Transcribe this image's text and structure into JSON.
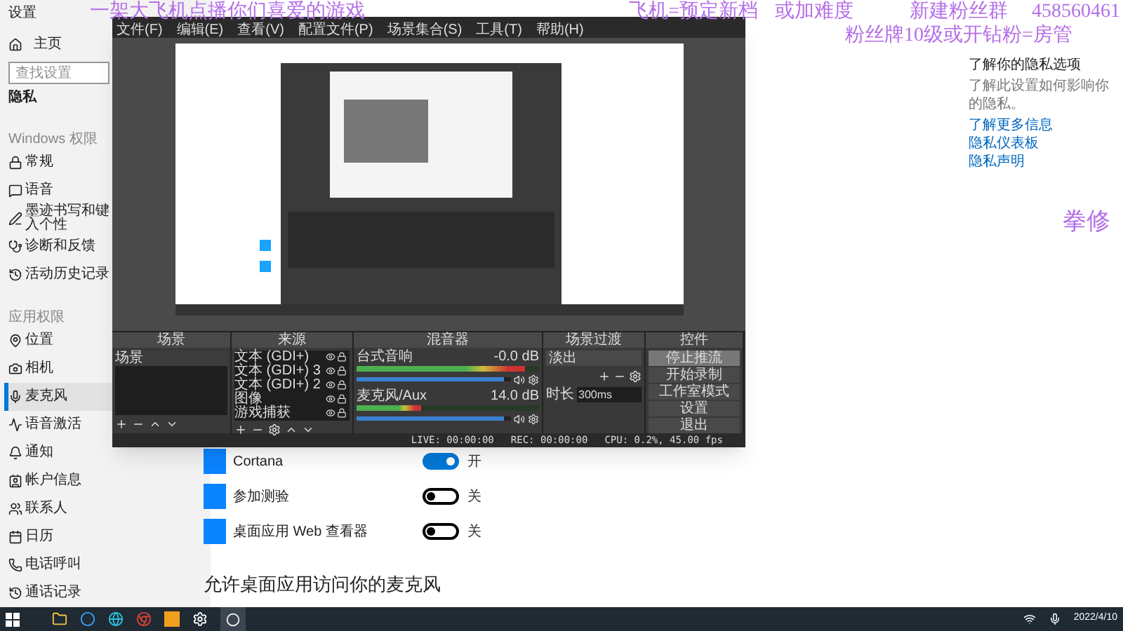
{
  "window": {
    "title": "设置"
  },
  "sidebar": {
    "home": "主页",
    "search": {
      "placeholder": "查找设置"
    },
    "section": "隐私",
    "groups": [
      {
        "heading": "Windows 权限",
        "items": [
          {
            "label": "常规",
            "selected": false
          },
          {
            "label": "语音",
            "selected": false
          },
          {
            "label": "墨迹书写和键入个性",
            "selected": false
          },
          {
            "label": "诊断和反馈",
            "selected": false
          },
          {
            "label": "活动历史记录",
            "selected": false
          }
        ]
      },
      {
        "heading": "应用权限",
        "items": [
          {
            "label": "位置",
            "selected": false
          },
          {
            "label": "相机",
            "selected": false
          },
          {
            "label": "麦克风",
            "selected": true
          },
          {
            "label": "语音激活",
            "selected": false
          },
          {
            "label": "通知",
            "selected": false
          },
          {
            "label": "帐户信息",
            "selected": false
          },
          {
            "label": "联系人",
            "selected": false
          },
          {
            "label": "日历",
            "selected": false
          },
          {
            "label": "电话呼叫",
            "selected": false
          },
          {
            "label": "通话记录",
            "selected": false
          }
        ]
      }
    ]
  },
  "apps": [
    {
      "name": "Cortana",
      "on": true,
      "state": "开"
    },
    {
      "name": "参加测验",
      "on": false,
      "state": "关"
    },
    {
      "name": "桌面应用 Web 查看器",
      "on": false,
      "state": "关"
    }
  ],
  "desktop_heading": "允许桌面应用访问你的麦克风",
  "privacy_panel": {
    "title": "了解你的隐私选项",
    "text": "了解此设置如何影响你的隐私。",
    "links": [
      "了解更多信息",
      "隐私仪表板",
      "隐私声明"
    ]
  },
  "obs": {
    "menu": [
      "文件(F)",
      "编辑(E)",
      "查看(V)",
      "配置文件(P)",
      "场景集合(S)",
      "工具(T)",
      "帮助(H)"
    ],
    "docks": {
      "scenes": "场景",
      "sources": "来源",
      "mixer": "混音器",
      "transitions": "场景过渡",
      "controls": "控件"
    },
    "scenes": [
      {
        "name": "场景",
        "selected": true
      }
    ],
    "sources": [
      "文本 (GDI+)",
      "文本 (GDI+) 3",
      "文本 (GDI+) 2",
      "图像",
      "游戏捕获"
    ],
    "channels": [
      {
        "name": "台式音响",
        "reading": "-0.0 dB",
        "meter": {
          "level": 0.92
        },
        "volume": {
          "level": 0.95
        }
      },
      {
        "name": "麦克风/Aux",
        "reading": "14.0 dB",
        "meter": {
          "level": 0.35
        },
        "volume": {
          "level": 0.95
        }
      }
    ],
    "transition": {
      "value": "淡出",
      "duration_label": "时长",
      "duration": "300ms"
    },
    "controls": [
      {
        "label": "停止推流",
        "selected": true
      },
      {
        "label": "开始录制",
        "selected": false
      },
      {
        "label": "工作室模式",
        "selected": false
      },
      {
        "label": "设置",
        "selected": false
      },
      {
        "label": "退出",
        "selected": false
      }
    ],
    "status": [
      "LIVE: 00:00:00",
      "REC: 00:00:00",
      "CPU: 0.2%, 45.00 fps"
    ]
  },
  "overlay": [
    "一架大飞机点播你们喜爱的游戏",
    "飞机=预定新档",
    "或加难度",
    "新建粉丝群",
    "458560461",
    "粉丝牌10级或开钻粉=房管",
    "拳修"
  ],
  "taskbar": {
    "date": "2022/4/10"
  }
}
